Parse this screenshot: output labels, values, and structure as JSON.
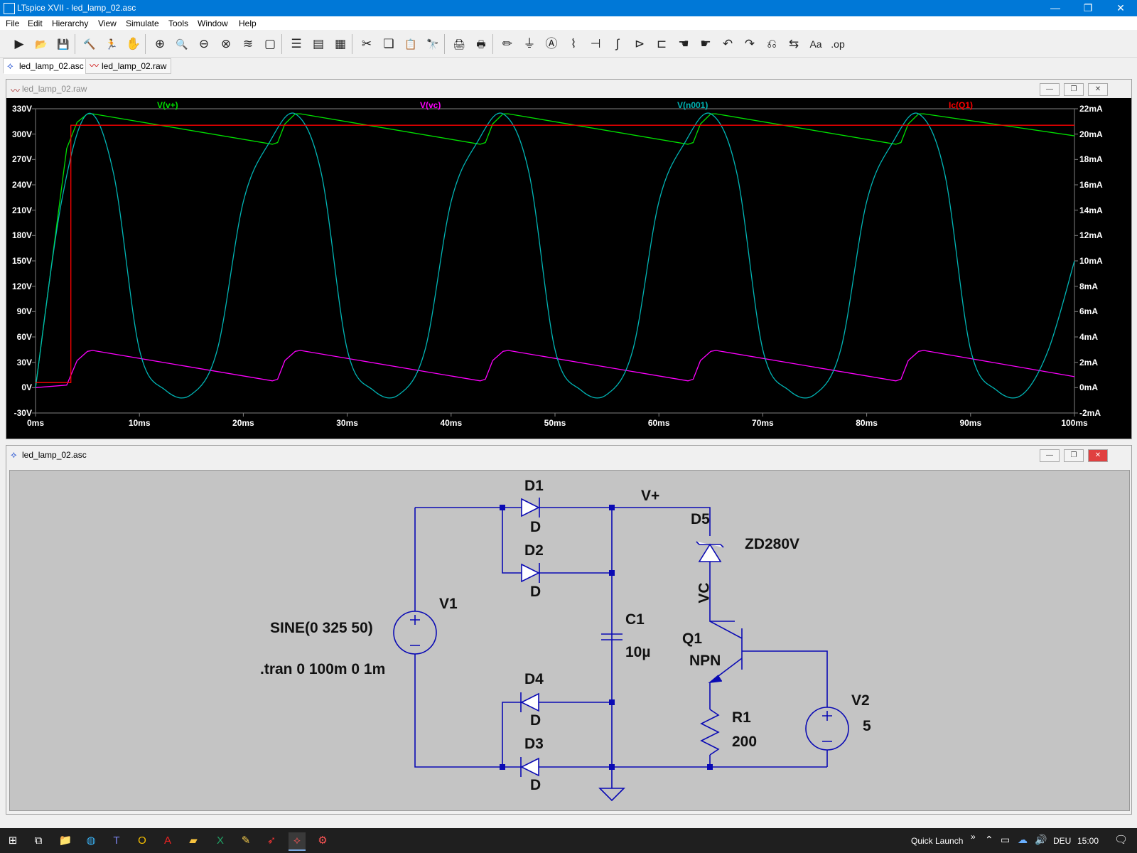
{
  "window": {
    "title": "LTspice XVII - led_lamp_02.asc",
    "minimize": "—",
    "maximize": "❐",
    "close": "✕"
  },
  "menu": {
    "items": [
      {
        "label": "File"
      },
      {
        "label": "Edit"
      },
      {
        "label": "Hierarchy"
      },
      {
        "label": "View"
      },
      {
        "label": "Simulate"
      },
      {
        "label": "Tools"
      },
      {
        "label": "Window"
      },
      {
        "label": "Help"
      }
    ]
  },
  "toolbar": {
    "buttons": [
      {
        "name": "run",
        "glyph": "▶"
      },
      {
        "name": "open",
        "glyph": "📂"
      },
      {
        "name": "save",
        "glyph": "💾"
      },
      {
        "name": "control-panel",
        "glyph": "🔨"
      },
      {
        "name": "run-pause",
        "glyph": "🏃"
      },
      {
        "name": "halt",
        "glyph": "✋"
      },
      {
        "name": "zoom-in",
        "glyph": "⊕"
      },
      {
        "name": "pan",
        "glyph": "🔍"
      },
      {
        "name": "zoom-out",
        "glyph": "⊖"
      },
      {
        "name": "zoom-fit",
        "glyph": "⊗"
      },
      {
        "name": "autorange",
        "glyph": "≋"
      },
      {
        "name": "delete-plot",
        "glyph": "▢"
      },
      {
        "name": "tile-h",
        "glyph": "☰"
      },
      {
        "name": "tile-v",
        "glyph": "▤"
      },
      {
        "name": "cascade",
        "glyph": "▦"
      },
      {
        "name": "cut",
        "glyph": "✂"
      },
      {
        "name": "copy",
        "glyph": "❏"
      },
      {
        "name": "paste",
        "glyph": "📋"
      },
      {
        "name": "find",
        "glyph": "🔭"
      },
      {
        "name": "print-setup",
        "glyph": "🖨"
      },
      {
        "name": "print",
        "glyph": "🖶"
      },
      {
        "name": "draw-wire",
        "glyph": "✏"
      },
      {
        "name": "ground",
        "glyph": "⏚"
      },
      {
        "name": "label-net",
        "glyph": "Ⓐ"
      },
      {
        "name": "resistor",
        "glyph": "⌇"
      },
      {
        "name": "capacitor",
        "glyph": "⊣"
      },
      {
        "name": "inductor",
        "glyph": "∫"
      },
      {
        "name": "diode",
        "glyph": "⊳"
      },
      {
        "name": "component",
        "glyph": "⊏"
      },
      {
        "name": "move",
        "glyph": "☚"
      },
      {
        "name": "drag",
        "glyph": "☛"
      },
      {
        "name": "undo",
        "glyph": "↶"
      },
      {
        "name": "redo",
        "glyph": "↷"
      },
      {
        "name": "rotate",
        "glyph": "⎌"
      },
      {
        "name": "mirror",
        "glyph": "⇆"
      },
      {
        "name": "text",
        "glyph": "Aa"
      },
      {
        "name": "spice-directive",
        "glyph": ".op"
      }
    ]
  },
  "tabs": [
    {
      "label": "led_lamp_02.asc",
      "active": true
    },
    {
      "label": "led_lamp_02.raw",
      "active": false
    }
  ],
  "waveform_window": {
    "title": "led_lamp_02.raw",
    "traces": [
      {
        "label": "V(v+)",
        "color": "#00e000"
      },
      {
        "label": "V(vc)",
        "color": "#ff00ff"
      },
      {
        "label": "V(n001)",
        "color": "#00b4b4"
      },
      {
        "label": "Ic(Q1)",
        "color": "#ff0000"
      }
    ],
    "y_left_ticks": [
      "330V",
      "300V",
      "270V",
      "240V",
      "210V",
      "180V",
      "150V",
      "120V",
      "90V",
      "60V",
      "30V",
      "0V",
      "-30V"
    ],
    "y_right_ticks": [
      "22mA",
      "20mA",
      "18mA",
      "16mA",
      "14mA",
      "12mA",
      "10mA",
      "8mA",
      "6mA",
      "4mA",
      "2mA",
      "0mA",
      "-2mA"
    ],
    "x_ticks": [
      "0ms",
      "10ms",
      "20ms",
      "30ms",
      "40ms",
      "50ms",
      "60ms",
      "70ms",
      "80ms",
      "90ms",
      "100ms"
    ]
  },
  "chart_data": {
    "type": "line",
    "xlabel": "",
    "ylabel": "",
    "xlim": [
      0,
      100
    ],
    "ylim_left": [
      -30,
      330
    ],
    "ylim_right": [
      -2,
      22
    ],
    "grid": false,
    "series": [
      {
        "name": "V(v+)",
        "axis": "left",
        "x": [
          0,
          3.0,
          4.0,
          5.0,
          5.5,
          22.8,
          23.3,
          24.0,
          25.0,
          25.5,
          42.8,
          43.3,
          44.0,
          45.0,
          45.5,
          62.8,
          63.3,
          64.0,
          65.0,
          65.5,
          82.8,
          83.3,
          84.0,
          85.0,
          85.5,
          100
        ],
        "y": [
          0,
          283,
          314,
          324,
          324,
          288,
          290,
          312,
          324,
          324,
          288,
          290,
          312,
          324,
          324,
          288,
          290,
          312,
          324,
          324,
          288,
          290,
          312,
          324,
          324,
          298
        ]
      },
      {
        "name": "V(vc)",
        "axis": "left",
        "x": [
          0,
          3.0,
          4.0,
          5.0,
          5.5,
          22.8,
          23.3,
          24.0,
          25.0,
          25.5,
          42.8,
          43.3,
          44.0,
          45.0,
          45.5,
          62.8,
          63.3,
          64.0,
          65.0,
          65.5,
          82.8,
          83.3,
          84.0,
          85.0,
          85.5,
          100
        ],
        "y": [
          0,
          3,
          32,
          43,
          44,
          8,
          10,
          32,
          43,
          44,
          8,
          10,
          32,
          43,
          44,
          8,
          10,
          32,
          43,
          44,
          8,
          10,
          32,
          43,
          44,
          13
        ]
      },
      {
        "name": "V(n001)",
        "axis": "left",
        "x": [
          0,
          2.5,
          5.0,
          7.5,
          10.0,
          12.5,
          15.0,
          17.5,
          20.0,
          22.5,
          25.0,
          27.5,
          30.0,
          32.5,
          35.0,
          37.5,
          40.0,
          42.5,
          45.0,
          47.5,
          50.0,
          52.5,
          55.0,
          57.5,
          60.0,
          62.5,
          65.0,
          67.5,
          70.0,
          72.5,
          75.0,
          77.5,
          80.0,
          82.5,
          85.0,
          87.5,
          90.0,
          92.5,
          95.0,
          97.5,
          100
        ],
        "y": [
          0,
          220,
          324,
          254,
          45,
          -3,
          -8,
          45,
          220,
          290,
          324,
          254,
          45,
          -3,
          -8,
          45,
          220,
          290,
          324,
          254,
          45,
          -3,
          -8,
          45,
          220,
          290,
          324,
          254,
          45,
          -3,
          -8,
          45,
          220,
          290,
          324,
          254,
          45,
          -3,
          -8,
          45,
          150
        ]
      },
      {
        "name": "Ic(Q1)",
        "axis": "right",
        "x": [
          0,
          3.4,
          3.4,
          100
        ],
        "y": [
          0.4,
          0.4,
          20.7,
          20.7
        ]
      }
    ]
  },
  "schematic_window": {
    "title": "led_lamp_02.asc",
    "labels": {
      "d1": "D1",
      "d1_model": "D",
      "d2": "D2",
      "d2_model": "D",
      "d3": "D3",
      "d3_model": "D",
      "d4": "D4",
      "d4_model": "D",
      "d5": "D5",
      "d5_model": "ZD280V",
      "vplus": "V+",
      "vc": "VC",
      "v1": "V1",
      "v1_value": "SINE(0 325 50)",
      "tran": ".tran 0 100m 0 1m",
      "c1": "C1",
      "c1_value": "10µ",
      "q1": "Q1",
      "q1_model": "NPN",
      "r1": "R1",
      "r1_value": "200",
      "v2": "V2",
      "v2_value": "5"
    }
  },
  "taskbar": {
    "quick_launch": "Quick Launch",
    "chevron": "»",
    "lang": "DEU",
    "time": "15:00"
  }
}
